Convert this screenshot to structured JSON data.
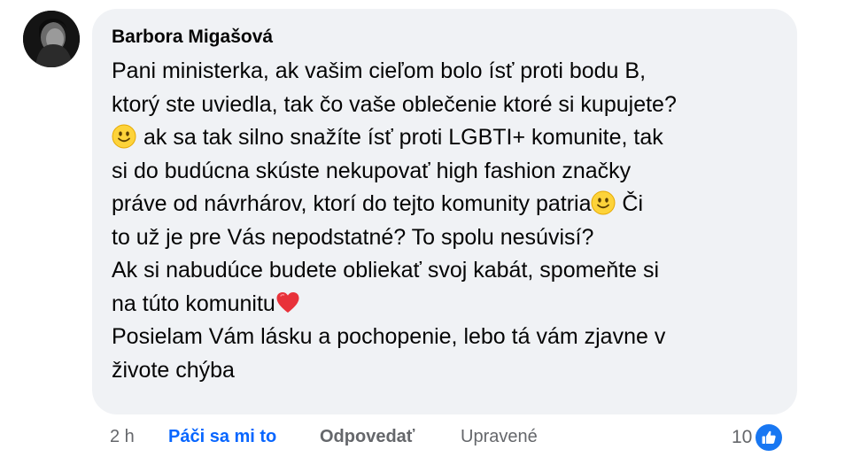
{
  "comment": {
    "author": "Barbora Migašová",
    "lines": [
      {
        "text": "Pani ministerka, ak vašim cieľom bolo ísť proti bodu B,"
      },
      {
        "text": "ktorý ste uviedla, tak čo vaše oblečenie ktoré si kupujete?"
      },
      {
        "text": "ak sa tak silno snažíte ísť proti LGBTI+ komunite, tak",
        "lead_emoji": "smiling-face-emoji"
      },
      {
        "text": "si do budúcna skúste nekupovať high fashion značky"
      },
      {
        "text_before": "práve od návrhárov, ktorí do tejto komunity patria",
        "inline_emoji": "smiling-face-emoji",
        "text_after": " Či"
      },
      {
        "text": "to už je pre Vás nepodstatné? To spolu nesúvisí?"
      },
      {
        "text": "Ak si nabudúce budete obliekať svoj kabát, spomeňte si"
      },
      {
        "text_before": "na túto komunitu",
        "inline_emoji": "red-heart-emoji",
        "text_after": ""
      },
      {
        "text": "Posielam Vám lásku a pochopenie, lebo tá vám zjavne v"
      },
      {
        "text": "živote chýba"
      }
    ]
  },
  "actions": {
    "time": "2 h",
    "like_label": "Páči sa mi to",
    "reply_label": "Odpovedať",
    "edited_label": "Upravené"
  },
  "reactions": {
    "count": "10",
    "icon": "thumbs-up-icon"
  },
  "colors": {
    "bubble": "#f0f2f5",
    "text": "#050505",
    "muted": "#65676b",
    "like_blue": "#0866ff",
    "reaction_blue": "#1877f2"
  }
}
